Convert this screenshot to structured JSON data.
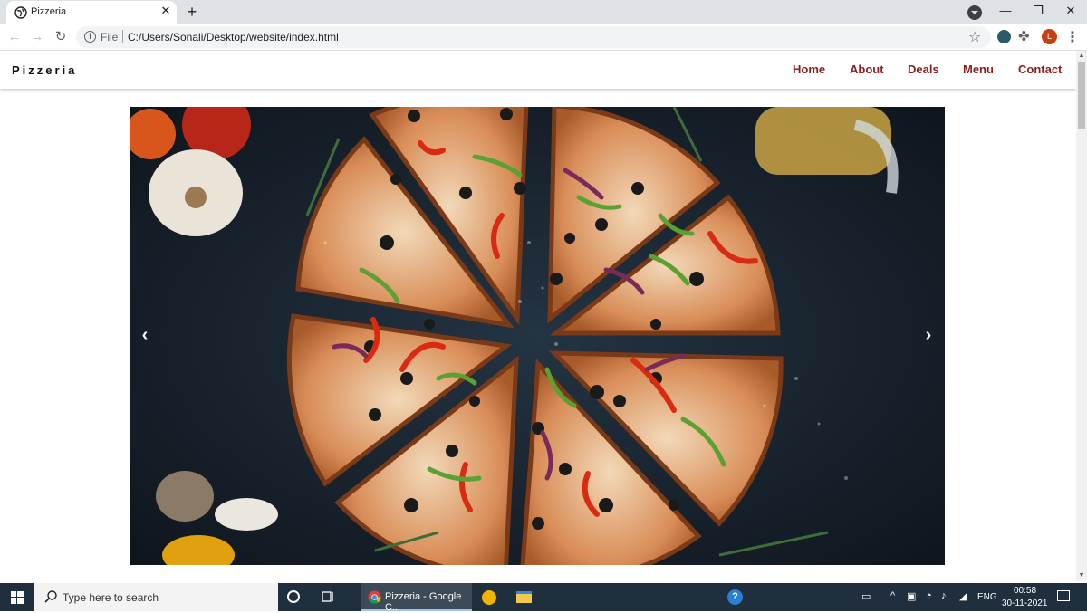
{
  "browser": {
    "tab_title": "Pizzeria",
    "tab_close": "✕",
    "new_tab": "+",
    "url_scheme": "File",
    "url": "C:/Users/Sonali/Desktop/website/index.html",
    "profile_initial": "L",
    "window_controls": {
      "minimize": "—",
      "maximize": "❐",
      "close": "✕"
    }
  },
  "site": {
    "brand": "Pizzeria",
    "nav": [
      "Home",
      "About",
      "Deals",
      "Menu",
      "Contact"
    ],
    "nav_color": "#8a1f1f",
    "carousel_prev": "‹",
    "carousel_next": "›",
    "hero_image": "pizza-slices-photo"
  },
  "taskbar": {
    "search_placeholder": "Type here to search",
    "chrome_label": "Pizzeria - Google C...",
    "language": "ENG",
    "time": "00:58",
    "date": "30-11-2021"
  }
}
